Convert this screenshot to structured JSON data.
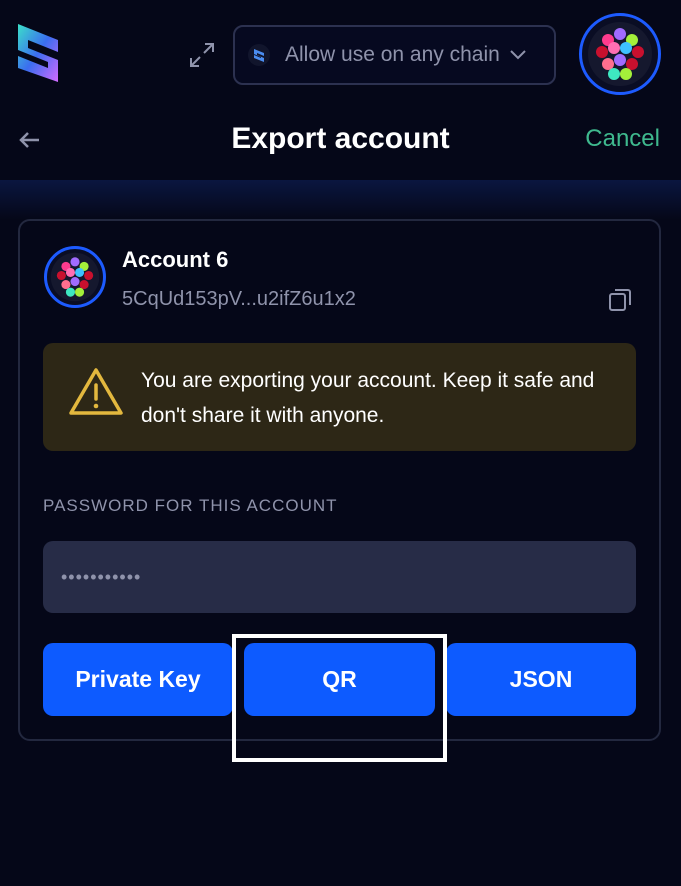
{
  "topbar": {
    "logo_icon": "subwallet-logo-icon",
    "expand_icon": "expand-icon",
    "chain_select": {
      "value": "Allow use on any chain"
    },
    "avatar_icon": "account-avatar-icon"
  },
  "header": {
    "back_icon": "arrow-left-icon",
    "title": "Export account",
    "cancel_label": "Cancel"
  },
  "account": {
    "name": "Account 6",
    "address": "5CqUd153pV...u2ifZ6u1x2",
    "copy_icon": "copy-icon"
  },
  "warning": {
    "icon": "warning-triangle-icon",
    "text": "You are exporting your account. Keep it safe and don't share it with anyone."
  },
  "password": {
    "label": "PASSWORD FOR THIS ACCOUNT",
    "value": "•••••••••••"
  },
  "buttons": {
    "private_key": "Private Key",
    "qr": "QR",
    "json": "JSON"
  },
  "colors": {
    "background": "#050718",
    "primary": "#0d5bff",
    "cancel": "#3fb98e",
    "warning_bg": "#2d2716",
    "warning_icon": "#e3b83e"
  }
}
